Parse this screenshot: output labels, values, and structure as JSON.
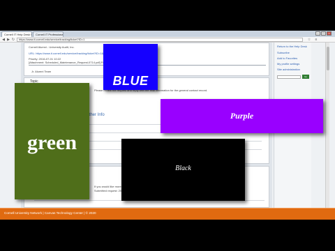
{
  "browser": {
    "tabs": [
      "Cornell IT Help Desk Ser...",
      "Cornell IT Professionals ..."
    ],
    "url": "https://www.it.cornell.edu/service/tracking/ticket?ID=1",
    "panel1": {
      "line1": "Cornell Alumni - University Audit, Inc.",
      "line2": "URL: https://www.it.cornell.edu/service/tracking/ticket?ID=1&action=view",
      "line3": "Priority: 2016-07-01 10:22",
      "line4": "[Attachment: Scheduled_Maintenance_Request-0714.pdf] Forwarded message",
      "author": "Jr. Alumni Team"
    },
    "panel2": {
      "tab": "Topic",
      "note": "Please review the request and reply with the final information for the general contact record.",
      "heading": "Other Info"
    },
    "panel3": {
      "lines": [
        "If you would like more detail, please attach any supporting materials or notes.",
        "Submitted request: 2016-08-05 (Reference)"
      ]
    },
    "sidebar": {
      "items": [
        "Return to the Help Desk",
        "Subscribe",
        "Add to Favorites",
        "My profile settings",
        "Site administration"
      ],
      "button": "Go"
    }
  },
  "footer": {
    "text": "Cornell University Network | Canvas Technology Center | © 2020"
  },
  "cards": {
    "blue": "BLUE",
    "green": "green",
    "purple": "Purple",
    "black": "Black"
  },
  "colors": {
    "blue": "#1500ff",
    "green": "#4f6e1a",
    "purple": "#9900ff",
    "black": "#000000",
    "footer": "#e06a10"
  }
}
